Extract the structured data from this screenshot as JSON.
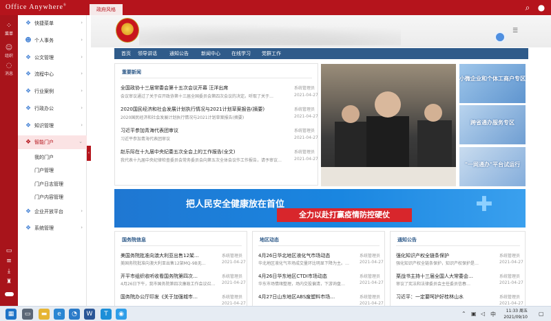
{
  "topbar": {
    "brand": "Office Anywhere",
    "brand_mark": "®",
    "tab_label": "政府风格"
  },
  "rail": {
    "items": [
      {
        "icon": "grid-icon",
        "label": "菜单"
      },
      {
        "icon": "user-icon",
        "label": "组织"
      },
      {
        "icon": "chat-icon",
        "label": "消息"
      }
    ],
    "bottom_icons": [
      "monitor-icon",
      "list-icon",
      "download-icon",
      "shirt-icon"
    ]
  },
  "sidebar": {
    "items": [
      {
        "label": "快捷菜单",
        "icon": "cubes-icon"
      },
      {
        "label": "个人事务",
        "icon": "person-icon"
      },
      {
        "label": "公文管理",
        "icon": "cubes-icon"
      },
      {
        "label": "流程中心",
        "icon": "cubes-icon"
      },
      {
        "label": "行业案例",
        "icon": "cubes-icon"
      },
      {
        "label": "行政办公",
        "icon": "cubes-icon"
      },
      {
        "label": "知识管理",
        "icon": "cubes-icon"
      },
      {
        "label": "智能门户",
        "icon": "cubes-icon"
      },
      {
        "label": "企业开放平台",
        "icon": "cubes-icon"
      },
      {
        "label": "系统管理",
        "icon": "cubes-icon"
      }
    ],
    "submenu": [
      "我的门户",
      "门户管理",
      "门户日志管理",
      "门户内容管理"
    ]
  },
  "nav": {
    "items": [
      "首页",
      "领导讲话",
      "通知公告",
      "新闻中心",
      "在线学习",
      "党群工作"
    ]
  },
  "news": {
    "title": "重要新闻",
    "rows": [
      {
        "title": "全国政协十三届常委会第十五次会议开幕 汪洋出席",
        "desc": "会议审议通过了关于召开政协第十三届全国委员会第四次会议的决定。听取了关于…",
        "source": "系统管理员",
        "date": "2021-04-27"
      },
      {
        "title": "2020国民经济和社会发展计划执行情况与2021计划草案报告(摘要)",
        "desc": "2020国民经济和社会发展计划执行情况与2021计划草案报告(摘要)",
        "source": "系统管理员",
        "date": "2021-04-27"
      },
      {
        "title": "习近平参加青海代表团审议",
        "desc": "习近平参加青海代表团审议",
        "source": "系统管理员",
        "date": "2021-04-27"
      },
      {
        "title": "赵乐际在十九届中央纪委五次全会上的工作报告(全文)",
        "desc": "我代表十九届中央纪律检查委员会常务委员会向第五次全体会议作工作报告，请予审议…",
        "source": "系统管理员",
        "date": "2021-04-27"
      }
    ]
  },
  "side_cards": [
    "小微企业和个体工商户专区",
    "跨省通办服务专区",
    "\"一网通办\"平台试运行"
  ],
  "banner": {
    "title": "把人民安全健康放在首位",
    "subtitle": "全力以赴打赢疫情防控硬仗"
  },
  "bottom_panels": [
    {
      "title": "国务院信息",
      "rows": [
        {
          "title": "美国务院批准向澳大利亚出售12架…",
          "desc": "美国务院批准向澳大利亚出售12架MQ-9B无…",
          "source": "系统管理员",
          "date": "2021-04-27"
        },
        {
          "title": "开平市组织收听收看国务院第四次…",
          "desc": "4月26日下午，我市国务院第四次廉政工作会议召…",
          "source": "系统管理员",
          "date": "2021-04-27"
        },
        {
          "title": "国务院办公厅印发《关于加强城市…",
          "desc": "",
          "source": "系统管理员",
          "date": "2021-04-27"
        }
      ]
    },
    {
      "title": "地区动态",
      "rows": [
        {
          "title": "4月26日华北地区液化气市场动态",
          "desc": "华北地区液化气市场成交量环比明显下降为主。…",
          "source": "系统管理员",
          "date": "2021-04-27"
        },
        {
          "title": "4月26日华东地区CTDI市场动态",
          "desc": "华东市场情绪整理，场内交投偏清，下游询盘…",
          "source": "系统管理员",
          "date": "2021-04-27"
        },
        {
          "title": "4月27日山东地区ABS废塑料市场…",
          "desc": "",
          "source": "系统管理员",
          "date": "2021-04-27"
        }
      ]
    },
    {
      "title": "通知公告",
      "rows": [
        {
          "title": "强化知识产权全链条保护",
          "desc": "强化知识产权全链条保护，知识产权保护是…",
          "source": "系统管理员",
          "date": "2021-04-27"
        },
        {
          "title": "栗战书主持十三届全国人大常委会…",
          "desc": "审议了宪法和法律委员会主任委员信春…",
          "source": "系统管理员",
          "date": "2021-04-27"
        },
        {
          "title": "习近平：一定要呵护好桂林山水",
          "desc": "",
          "source": "系统管理员",
          "date": "2021-04-27"
        }
      ]
    }
  ],
  "taskbar": {
    "apps": [
      {
        "name": "start-icon",
        "color": "#1e73c7"
      },
      {
        "name": "task-view-icon",
        "color": "#5b6777"
      },
      {
        "name": "file-explorer-icon",
        "color": "#e6b534"
      },
      {
        "name": "ie-browser-icon",
        "color": "#2a86d3"
      },
      {
        "name": "edge-browser-icon",
        "color": "#2b7bc9"
      },
      {
        "name": "word-icon",
        "color": "#2b5797"
      },
      {
        "name": "app-td-icon",
        "color": "#1c8fd8"
      },
      {
        "name": "browser-icon",
        "color": "#2f9ee8"
      }
    ],
    "time": "11:33 周五",
    "date": "2021/09/10"
  }
}
